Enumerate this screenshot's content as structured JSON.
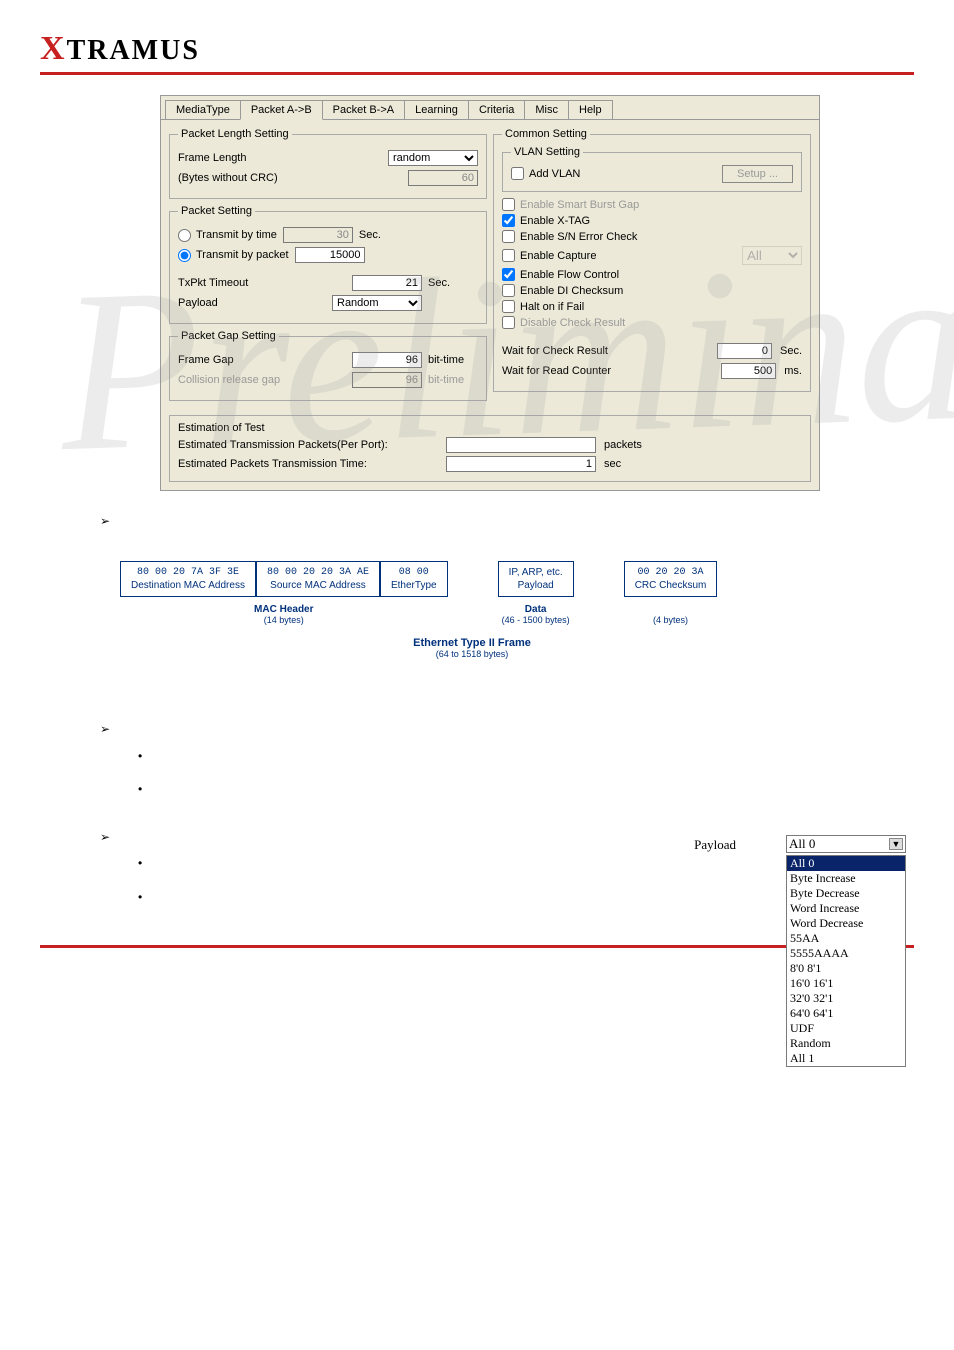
{
  "brand": "XTRAMUS",
  "tabs": [
    "MediaType",
    "Packet A->B",
    "Packet B->A",
    "Learning",
    "Criteria",
    "Misc",
    "Help"
  ],
  "active_tab": "Packet A->B",
  "pls": {
    "legend": "Packet Length Setting",
    "frame_length_label": "Frame Length",
    "frame_length_value": "random",
    "bytes_label": "(Bytes without CRC)",
    "bytes_value": "60"
  },
  "ps": {
    "legend": "Packet Setting",
    "tx_time_label": "Transmit by time",
    "tx_time_value": "30",
    "tx_time_unit": "Sec.",
    "tx_pkt_label": "Transmit by packet",
    "tx_pkt_value": "15000",
    "timeout_label": "TxPkt Timeout",
    "timeout_value": "21",
    "timeout_unit": "Sec.",
    "payload_label": "Payload",
    "payload_value": "Random"
  },
  "pgs": {
    "legend": "Packet Gap Setting",
    "frame_gap_label": "Frame Gap",
    "frame_gap_value": "96",
    "frame_gap_unit": "bit-time",
    "collision_label": "Collision release gap",
    "collision_value": "96",
    "collision_unit": "bit-time"
  },
  "cs": {
    "legend": "Common Setting",
    "vlan_legend": "VLAN Setting",
    "add_vlan": "Add VLAN",
    "setup_btn": "Setup ...",
    "opts": [
      {
        "label": "Enable Smart Burst Gap",
        "checked": false,
        "disabled": true
      },
      {
        "label": "Enable X-TAG",
        "checked": true,
        "disabled": false
      },
      {
        "label": "Enable S/N Error Check",
        "checked": false,
        "disabled": false
      },
      {
        "label": "Enable Capture",
        "checked": false,
        "disabled": false
      },
      {
        "label": "Enable Flow Control",
        "checked": true,
        "disabled": false
      },
      {
        "label": "Enable DI Checksum",
        "checked": false,
        "disabled": false
      },
      {
        "label": "Halt on if Fail",
        "checked": false,
        "disabled": false
      },
      {
        "label": "Disable Check Result",
        "checked": false,
        "disabled": true
      }
    ],
    "capture_sel": "All",
    "wait_check_label": "Wait for Check Result",
    "wait_check_value": "0",
    "wait_check_unit": "Sec.",
    "wait_read_label": "Wait for Read Counter",
    "wait_read_value": "500",
    "wait_read_unit": "ms."
  },
  "est": {
    "legend": "Estimation of Test",
    "r1_label": "Estimated Transmission Packets(Per Port):",
    "r1_value": "",
    "r1_unit": "packets",
    "r2_label": "Estimated Packets Transmission Time:",
    "r2_value": "1",
    "r2_unit": "sec"
  },
  "frame": {
    "dest_hex": "80 00 20 7A 3F 3E",
    "dest_lbl": "Destination MAC Address",
    "src_hex": "80 00 20 20 3A AE",
    "src_lbl": "Source MAC Address",
    "eth_hex": "08 00",
    "eth_lbl": "EtherType",
    "mac_header": "MAC Header",
    "mac_bytes": "(14 bytes)",
    "data_top": "IP, ARP, etc.",
    "data_lbl": "Payload",
    "data_header": "Data",
    "data_bytes": "(46 - 1500 bytes)",
    "crc_hex": "00 20 20 3A",
    "crc_lbl": "CRC Checksum",
    "crc_bytes": "(4 bytes)",
    "title": "Ethernet Type II Frame",
    "title_sub": "(64 to 1518 bytes)"
  },
  "payload_list": {
    "label": "Payload",
    "selected": "All 0",
    "options": [
      "All 0",
      "Byte Increase",
      "Byte Decrease",
      "Word Increase",
      "Word Decrease",
      "55AA",
      "5555AAAA",
      "8'0 8'1",
      "16'0 16'1",
      "32'0 32'1",
      "64'0 64'1",
      "UDF",
      "Random",
      "All 1"
    ]
  },
  "watermark": "Preliminary"
}
